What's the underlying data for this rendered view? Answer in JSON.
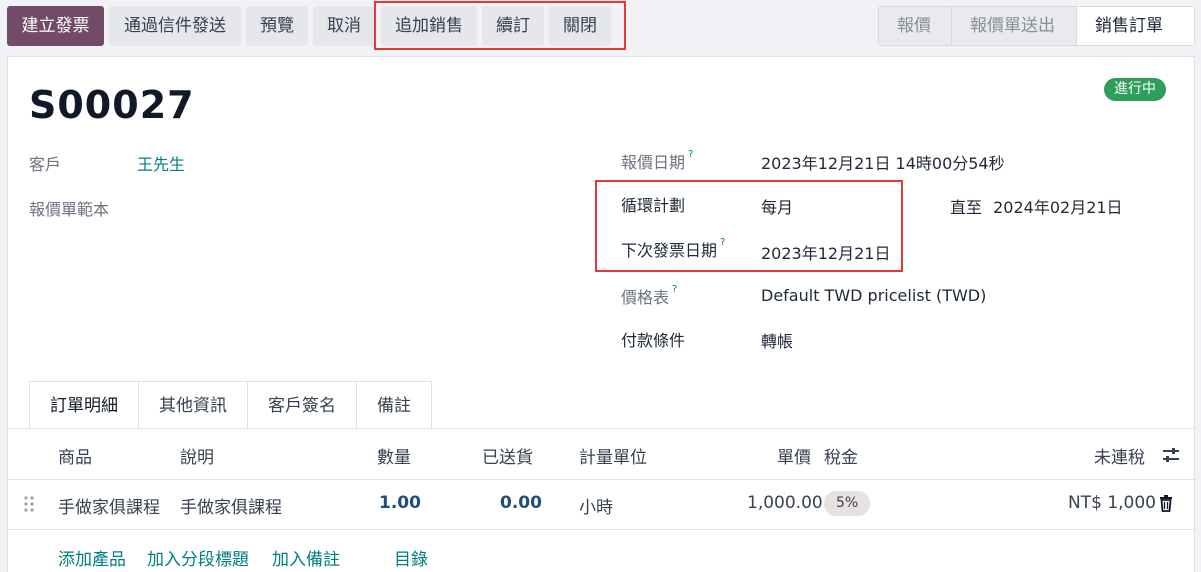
{
  "toolbar": {
    "create_invoice": "建立發票",
    "send_by_email": "通過信件發送",
    "preview": "預覽",
    "cancel": "取消",
    "upsell": "追加銷售",
    "renew": "續訂",
    "close": "關閉"
  },
  "statusbar": {
    "stages": [
      "報價",
      "報價單送出",
      "銷售訂單"
    ],
    "active": "銷售訂單"
  },
  "record": {
    "name": "S00027",
    "status": "進行中"
  },
  "fields": {
    "customer_label": "客戶",
    "customer_value": "王先生",
    "template_label": "報價單範本",
    "quote_date_label": "報價日期",
    "quote_date_value": "2023年12月21日 14時00分54秒",
    "plan_label": "循環計劃",
    "plan_value": "每月",
    "until_label": "直至",
    "until_value": "2024年02月21日",
    "next_invoice_label": "下次發票日期",
    "next_invoice_value": "2023年12月21日",
    "pricelist_label": "價格表",
    "pricelist_value": "Default TWD pricelist (TWD)",
    "payment_terms_label": "付款條件",
    "payment_terms_value": "轉帳",
    "help_mark": "?"
  },
  "tabs": [
    "訂單明細",
    "其他資訊",
    "客戶簽名",
    "備註"
  ],
  "table": {
    "headers": {
      "product": "商品",
      "description": "說明",
      "quantity": "數量",
      "delivered": "已送貨",
      "uom": "計量單位",
      "price": "單價",
      "taxes": "稅金",
      "subtotal": "未連稅"
    },
    "rows": [
      {
        "product": "手做家俱課程",
        "description": "手做家俱課程",
        "quantity": "1.00",
        "delivered": "0.00",
        "uom": "小時",
        "price": "1,000.00",
        "tax": "5%",
        "subtotal": "NT$ 1,000"
      }
    ],
    "add_links": {
      "add_product": "添加產品",
      "add_section": "加入分段標題",
      "add_note": "加入備註",
      "catalog": "目錄"
    }
  },
  "icons": {
    "drag_handle": "drag-handle-icon",
    "trash": "trash-icon",
    "settings_toggle": "column-settings-icon"
  },
  "colors": {
    "primary": "#714b67",
    "status_green": "#2e9e5b",
    "link": "#017e84",
    "highlight": "#e53935"
  }
}
